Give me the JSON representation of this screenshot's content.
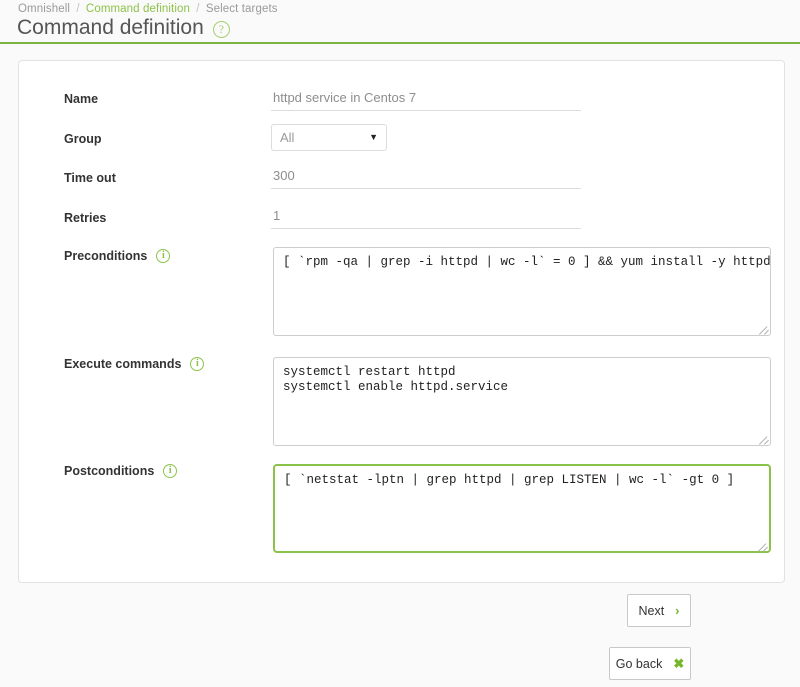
{
  "breadcrumb": {
    "items": [
      {
        "label": "Omnishell",
        "active": false
      },
      {
        "label": "Command definition",
        "active": true
      },
      {
        "label": "Select targets",
        "active": false
      }
    ],
    "separator": "/"
  },
  "header": {
    "title": "Command definition",
    "help_icon": "help-circle-icon",
    "help_glyph": "?",
    "accent_color": "#7cb342"
  },
  "form": {
    "name": {
      "label": "Name",
      "value": "httpd service in Centos 7",
      "placeholder": "Name"
    },
    "group": {
      "label": "Group",
      "value": "All",
      "options": [
        "All"
      ],
      "caret_glyph": "▼"
    },
    "timeout": {
      "label": "Time out",
      "value": "300",
      "placeholder": "Time out"
    },
    "retries": {
      "label": "Retries",
      "value": "1",
      "placeholder": "Retries"
    },
    "preconditions": {
      "label": "Preconditions",
      "info_icon": "info-circle-icon",
      "info_glyph": "i",
      "value": "[ `rpm -qa | grep -i httpd | wc -l` = 0 ] && yum install -y httpd",
      "placeholder": "Preconditions",
      "focused": false
    },
    "execute_commands": {
      "label": "Execute commands",
      "info_icon": "info-circle-icon",
      "info_glyph": "i",
      "value": "systemctl restart httpd\nsystemctl enable httpd.service",
      "placeholder": "Execute commands",
      "focused": false
    },
    "postconditions": {
      "label": "Postconditions",
      "info_icon": "info-circle-icon",
      "info_glyph": "i",
      "value": "[ `netstat -lptn | grep httpd | grep LISTEN | wc -l` -gt 0 ]",
      "placeholder": "Postconditions",
      "focused": true,
      "focus_color": "#8bc34a"
    }
  },
  "actions": {
    "next": {
      "label": "Next",
      "icon": "chevron-right-icon",
      "glyph": "›"
    },
    "go_back": {
      "label": "Go back",
      "icon": "close-x-icon",
      "glyph": "✖"
    }
  }
}
